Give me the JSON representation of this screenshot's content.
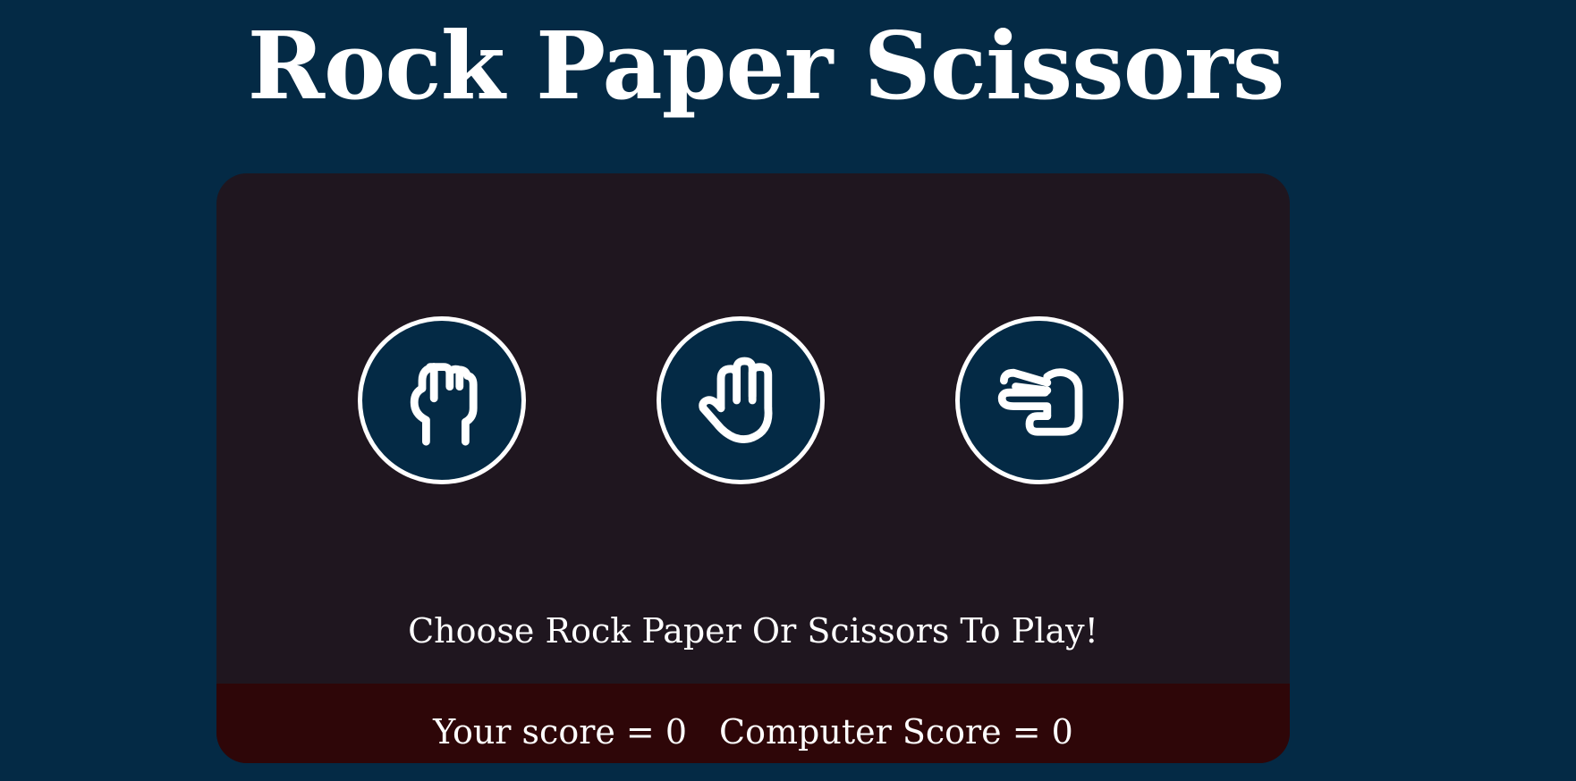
{
  "title": "Rock Paper Scissors",
  "choices": [
    {
      "label": "Rock",
      "icon": "rock-fist-icon"
    },
    {
      "label": "Paper",
      "icon": "paper-hand-icon"
    },
    {
      "label": "Scissors",
      "icon": "scissors-hand-icon"
    }
  ],
  "message": "Choose Rock Paper Or Scissors To Play!",
  "score": {
    "player_text": "Your score = 0",
    "computer_text": "Computer Score = 0",
    "player": 0,
    "computer": 0
  },
  "colors": {
    "background": "#042a45",
    "panel": "#1f161f",
    "score_bar": "#2e0608",
    "choice_fill": "#042a45",
    "text": "#ffffff"
  }
}
